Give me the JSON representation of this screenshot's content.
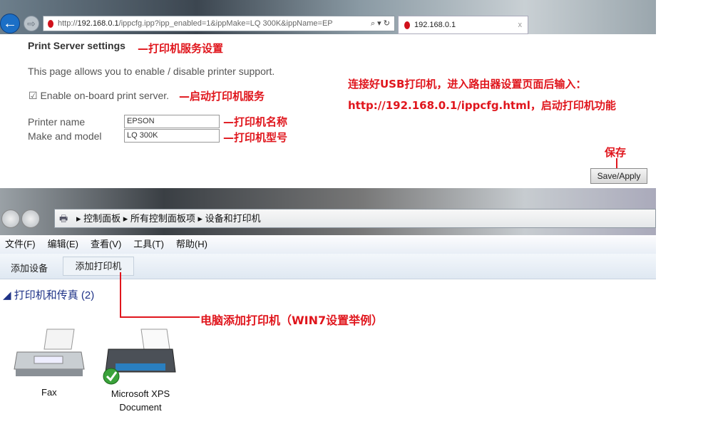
{
  "browser": {
    "url_prefix": "http://",
    "url_host": "192.168.0.1",
    "url_path": "/ippcfg.ipp?ipp_enabled=1&ippMake=LQ 300K&ippName=EP",
    "tab_title": "192.168.0.1",
    "tab_close": "x",
    "search_icon": "⌕ ▾",
    "refresh_icon": "↻"
  },
  "router": {
    "title": "Print Server settings",
    "title_note": "—打印机服务设置",
    "description": "This page allows you to enable / disable printer support.",
    "enable_label": "Enable on-board print server.",
    "enable_checked": true,
    "enable_note": "—启动打印机服务",
    "printer_name_label": "Printer name",
    "printer_name_value": "EPSON",
    "printer_name_note": "—打印机名称",
    "model_label": "Make and model",
    "model_value": "LQ 300K",
    "model_note": "—打印机型号",
    "instruction_line1": "连接好USB打印机，进入路由器设置页面后输入：",
    "instruction_line2": "http://192.168.0.1/ippcfg.html，启动打印机功能",
    "save_note": "保存",
    "save_button": "Save/Apply"
  },
  "explorer": {
    "breadcrumb": [
      "控制面板",
      "所有控制面板项",
      "设备和打印机"
    ],
    "menu": [
      "文件(F)",
      "编辑(E)",
      "查看(V)",
      "工具(T)",
      "帮助(H)"
    ],
    "commands": [
      "添加设备",
      "添加打印机"
    ],
    "group_title": "打印机和传真 (2)",
    "add_note": "电脑添加打印机（WIN7设置举例）",
    "devices": [
      {
        "label": "Fax"
      },
      {
        "label": "Microsoft XPS Document"
      }
    ]
  },
  "colors": {
    "annotation": "#e0161d"
  }
}
